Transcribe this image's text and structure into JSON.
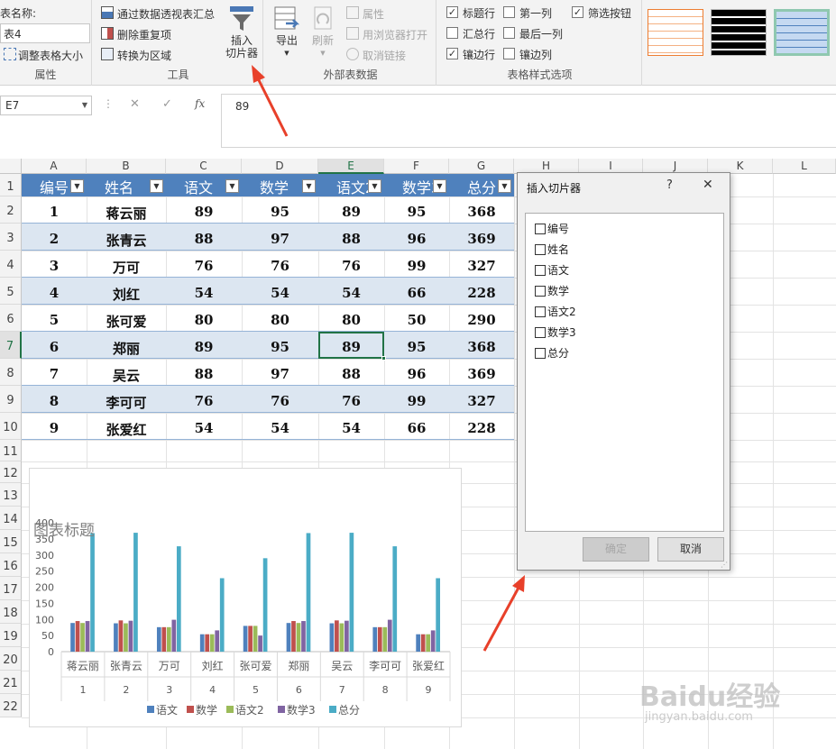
{
  "ribbon": {
    "properties": {
      "table_name_label": "表名称:",
      "table_name_value": "表4",
      "resize_label": "调整表格大小",
      "group_label": "属性"
    },
    "tools": {
      "pivot_label": "通过数据透视表汇总",
      "remove_dup_label": "删除重复项",
      "convert_label": "转换为区域",
      "slicer_line1": "插入",
      "slicer_line2": "切片器",
      "group_label": "工具"
    },
    "external": {
      "export_label": "导出",
      "refresh_label": "刷新",
      "properties_label": "属性",
      "browser_label": "用浏览器打开",
      "unlink_label": "取消链接",
      "group_label": "外部表数据"
    },
    "style_options": {
      "header_row": "标题行",
      "first_col": "第一列",
      "filter_btn": "筛选按钮",
      "total_row": "汇总行",
      "last_col": "最后一列",
      "banded_rows": "镶边行",
      "banded_cols": "镶边列",
      "group_label": "表格样式选项",
      "checked": {
        "header_row": true,
        "first_col": false,
        "filter_btn": true,
        "total_row": false,
        "last_col": false,
        "banded_rows": true,
        "banded_cols": false
      }
    }
  },
  "formula_bar": {
    "name_box": "E7",
    "cancel_icon": "✕",
    "enter_icon": "✓",
    "fx_label": "fx",
    "value": "89"
  },
  "columns": [
    "A",
    "B",
    "C",
    "D",
    "E",
    "F",
    "G",
    "H",
    "I",
    "J",
    "K",
    "L"
  ],
  "rows": [
    "1",
    "2",
    "3",
    "4",
    "5",
    "6",
    "7",
    "8",
    "9",
    "10",
    "11",
    "12",
    "13",
    "14",
    "15",
    "16",
    "17",
    "18",
    "19",
    "20",
    "21",
    "22"
  ],
  "table": {
    "headers": [
      "编号",
      "姓名",
      "语文",
      "数学",
      "语文2",
      "数学3",
      "总分"
    ],
    "rows": [
      [
        "1",
        "蒋云丽",
        "89",
        "95",
        "89",
        "95",
        "368"
      ],
      [
        "2",
        "张青云",
        "88",
        "97",
        "88",
        "96",
        "369"
      ],
      [
        "3",
        "万可",
        "76",
        "76",
        "76",
        "99",
        "327"
      ],
      [
        "4",
        "刘红",
        "54",
        "54",
        "54",
        "66",
        "228"
      ],
      [
        "5",
        "张可爱",
        "80",
        "80",
        "80",
        "50",
        "290"
      ],
      [
        "6",
        "郑丽",
        "89",
        "95",
        "89",
        "95",
        "368"
      ],
      [
        "7",
        "吴云",
        "88",
        "97",
        "88",
        "96",
        "369"
      ],
      [
        "8",
        "李可可",
        "76",
        "76",
        "76",
        "99",
        "327"
      ],
      [
        "9",
        "张爱红",
        "54",
        "54",
        "54",
        "66",
        "228"
      ]
    ],
    "header_color": "#4f81bd",
    "band_color": "#dce6f1"
  },
  "dialog": {
    "title": "插入切片器",
    "help": "?",
    "close": "✕",
    "fields": [
      "编号",
      "姓名",
      "语文",
      "数学",
      "语文2",
      "数学3",
      "总分"
    ],
    "ok_label": "确定",
    "cancel_label": "取消"
  },
  "chart_data": {
    "type": "bar",
    "title": "图表标题",
    "categories": [
      "蒋云丽",
      "张青云",
      "万可",
      "刘红",
      "张可爱",
      "郑丽",
      "吴云",
      "李可可",
      "张爱红"
    ],
    "category_groups": [
      "1",
      "2",
      "3",
      "4",
      "5",
      "6",
      "7",
      "8",
      "9"
    ],
    "ylim": [
      0,
      400
    ],
    "yticks": [
      "0",
      "50",
      "100",
      "150",
      "200",
      "250",
      "300",
      "350",
      "400"
    ],
    "legend_position": "bottom",
    "series": [
      {
        "name": "语文",
        "color": "#4f81bd",
        "values": [
          89,
          88,
          76,
          54,
          80,
          89,
          88,
          76,
          54
        ]
      },
      {
        "name": "数学",
        "color": "#c0504d",
        "values": [
          95,
          97,
          76,
          54,
          80,
          95,
          97,
          76,
          54
        ]
      },
      {
        "name": "语文2",
        "color": "#9bbb59",
        "values": [
          89,
          88,
          76,
          54,
          80,
          89,
          88,
          76,
          54
        ]
      },
      {
        "name": "数学3",
        "color": "#8064a2",
        "values": [
          95,
          96,
          99,
          66,
          50,
          95,
          96,
          99,
          66
        ]
      },
      {
        "name": "总分",
        "color": "#4bacc6",
        "values": [
          368,
          369,
          327,
          228,
          290,
          368,
          369,
          327,
          228
        ]
      }
    ]
  },
  "watermark": {
    "main": "Baidu经验",
    "sub": "jingyan.baidu.com"
  },
  "annotation_color": "#e8402a"
}
